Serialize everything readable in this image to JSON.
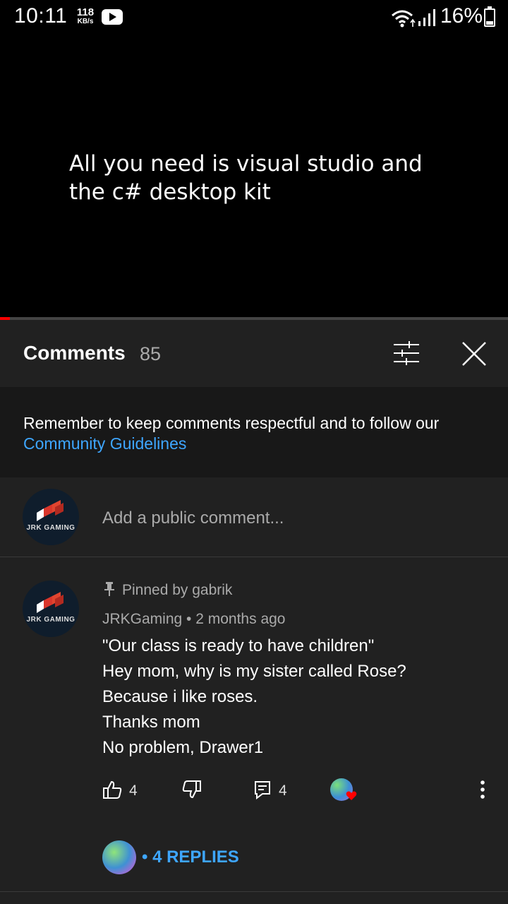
{
  "status_bar": {
    "time": "10:11",
    "speed_value": "118",
    "speed_unit": "KB/s",
    "battery": "16%"
  },
  "video": {
    "caption_line1": "All you need is visual studio and",
    "caption_line2": "the c# desktop kit",
    "progress_fraction": 0.02
  },
  "comments": {
    "title": "Comments",
    "count": "85",
    "notice_text": "Remember to keep comments respectful and to follow our ",
    "notice_link": "Community Guidelines",
    "add_placeholder": "Add a public comment...",
    "avatar_label": "JRK GAMING",
    "pinned_comment": {
      "pinned_text": "Pinned by gabrik",
      "author": "JRKGaming",
      "time": "2 months ago",
      "avatar_label": "JRK GAMING",
      "lines": [
        "\"Our class is ready to have children\"",
        "Hey mom, why is my sister called Rose?",
        "Because i like roses.",
        "Thanks mom",
        "No problem, Drawer1"
      ],
      "likes": "4",
      "replies_count": "4",
      "replies_label": "4 REPLIES",
      "replies_prefix": "•"
    }
  },
  "colors": {
    "panel_bg": "#212121",
    "notice_bg": "#181818",
    "link": "#3ea6ff",
    "progress": "#ff0000"
  }
}
